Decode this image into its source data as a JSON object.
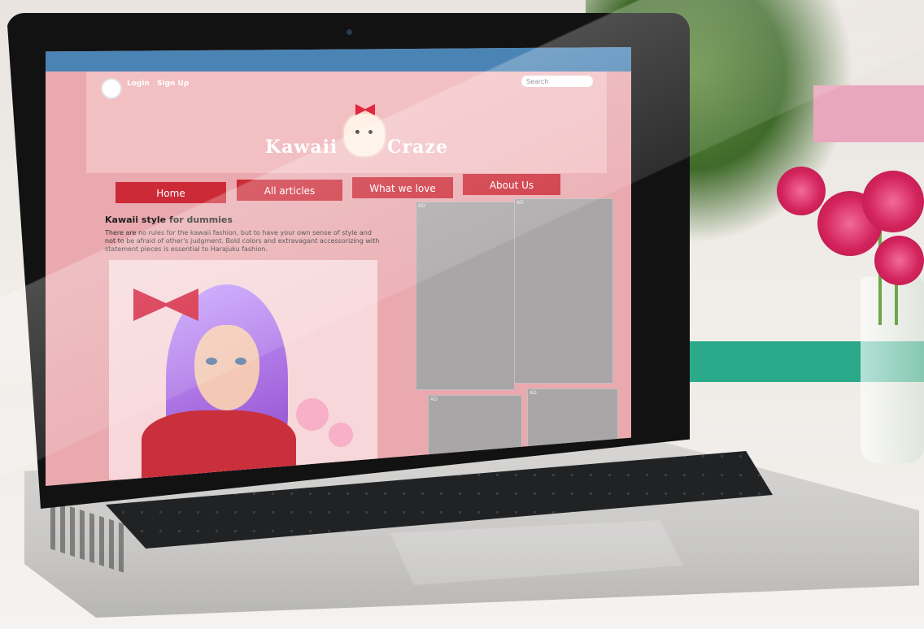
{
  "scene": {
    "accent_colors": {
      "nav_button": "#cc2a36",
      "header_bar": "#4a84b5",
      "page_bg": "#e9a9ae",
      "header_band": "#f2bfc3"
    }
  },
  "website": {
    "header": {
      "login_label": "Login",
      "signup_label": "Sign Up",
      "search_placeholder": "Search",
      "logo_left": "Kawaii",
      "logo_right": "Craze"
    },
    "nav": {
      "items": [
        {
          "label": "Home"
        },
        {
          "label": "All articles"
        },
        {
          "label": "What we love"
        },
        {
          "label": "About Us"
        }
      ]
    },
    "article": {
      "title": "Kawaii style for dummies",
      "body": "There are no rules for the kawaii fashion, but to have your own sense of style and not to be afraid of other's judgment. Bold colors and extravagant accessorizing with statement pieces is essential to Harajuku fashion."
    },
    "ads": [
      {
        "label": "AD"
      },
      {
        "label": "AD"
      },
      {
        "label": "AD"
      },
      {
        "label": "AD"
      }
    ]
  }
}
